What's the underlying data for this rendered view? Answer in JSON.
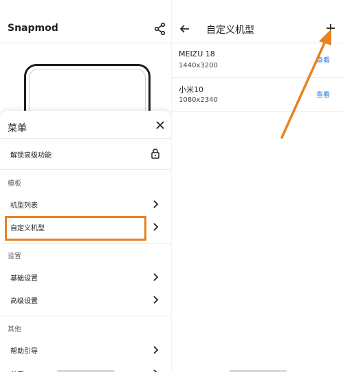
{
  "left": {
    "app_title": "Snapmod",
    "menu": {
      "title": "菜单",
      "unlock_label": "解锁高级功能",
      "sections": [
        {
          "header": "模板",
          "items": [
            "机型列表",
            "自定义机型"
          ]
        },
        {
          "header": "设置",
          "items": [
            "基础设置",
            "高级设置"
          ]
        },
        {
          "header": "其他",
          "items": [
            "帮助引导",
            "关于"
          ]
        }
      ],
      "highlighted_item": "自定义机型"
    }
  },
  "right": {
    "title": "自定义机型",
    "models": [
      {
        "name": "MEIZU 18",
        "resolution": "1440x3200",
        "action": "查看"
      },
      {
        "name": "小米10",
        "resolution": "1080x2340",
        "action": "查看"
      }
    ]
  },
  "colors": {
    "highlight": "#e8811f",
    "annotation_arrow": "#e8811f",
    "link": "#2d7bd3"
  },
  "icons": {
    "share": "share-icon",
    "close": "close-icon",
    "lock": "lock-icon",
    "chevron": "chevron-right-icon",
    "back": "arrow-left-icon",
    "add": "plus-icon"
  }
}
